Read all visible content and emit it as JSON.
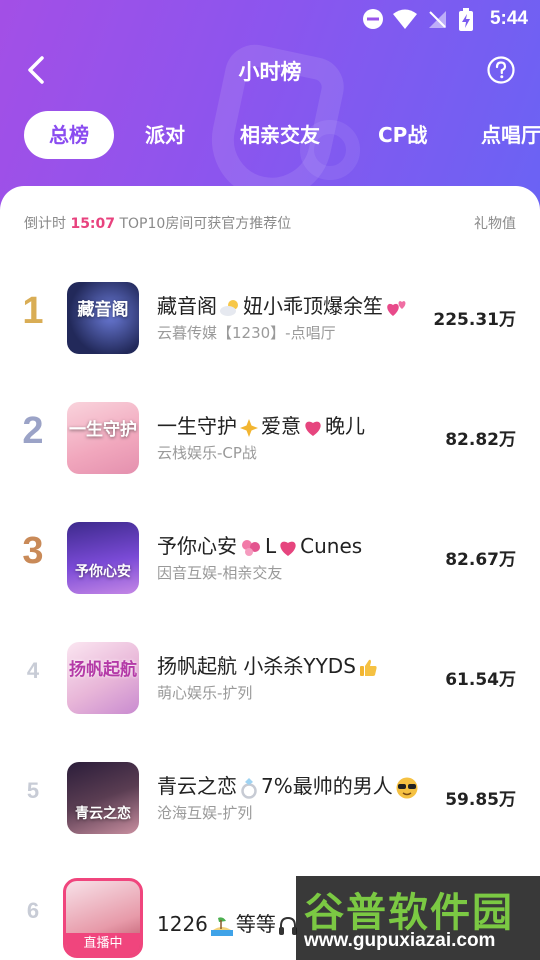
{
  "status_bar": {
    "time": "5:44"
  },
  "header": {
    "title": "小时榜"
  },
  "tabs": [
    "总榜",
    "派对",
    "相亲交友",
    "CP战",
    "点唱厅"
  ],
  "subheader": {
    "countdown_label": "倒计时",
    "countdown_time": "15:07",
    "notice": "TOP10房间可获官方推荐位",
    "value_label": "礼物值"
  },
  "rows": [
    {
      "rank": "1",
      "name_a": "藏音阁",
      "name_b": "妞小乖顶爆余笙",
      "cover_text": "藏音阁",
      "subtitle": "云暮传媒【1230】-点唱厅",
      "value": "225.31万"
    },
    {
      "rank": "2",
      "name_a": "一生守护",
      "name_b": "爱意",
      "name_c": "晚儿",
      "cover_text": "一生守护",
      "subtitle": "云栈娱乐-CP战",
      "value": "82.82万"
    },
    {
      "rank": "3",
      "name_a": "予你心安",
      "name_b": "L",
      "name_c": "Cunes",
      "cover_text": "予你心安",
      "subtitle": "因音互娱-相亲交友",
      "value": "82.67万"
    },
    {
      "rank": "4",
      "name_a": "扬帆起航 小杀杀YYDS",
      "cover_text": "扬帆起航",
      "subtitle": "萌心娱乐-扩列",
      "value": "61.54万"
    },
    {
      "rank": "5",
      "name_a": "青云之恋",
      "name_b": "7%最帅的男人",
      "cover_text": "青云之恋",
      "subtitle": "沧海互娱-扩列",
      "value": "59.85万"
    },
    {
      "rank": "6",
      "name_a": "1226",
      "name_b": "等等",
      "live_badge": "直播中",
      "subtitle": "",
      "value": ""
    }
  ],
  "watermark": {
    "title": "谷普软件园",
    "url": "www.gupuxiazai.com"
  },
  "colors": {
    "accent": "#8a4cf0",
    "countdown": "#e8427e",
    "gold": "#d9ad55",
    "silver": "#9ba3c7",
    "bronze": "#c98a58"
  }
}
